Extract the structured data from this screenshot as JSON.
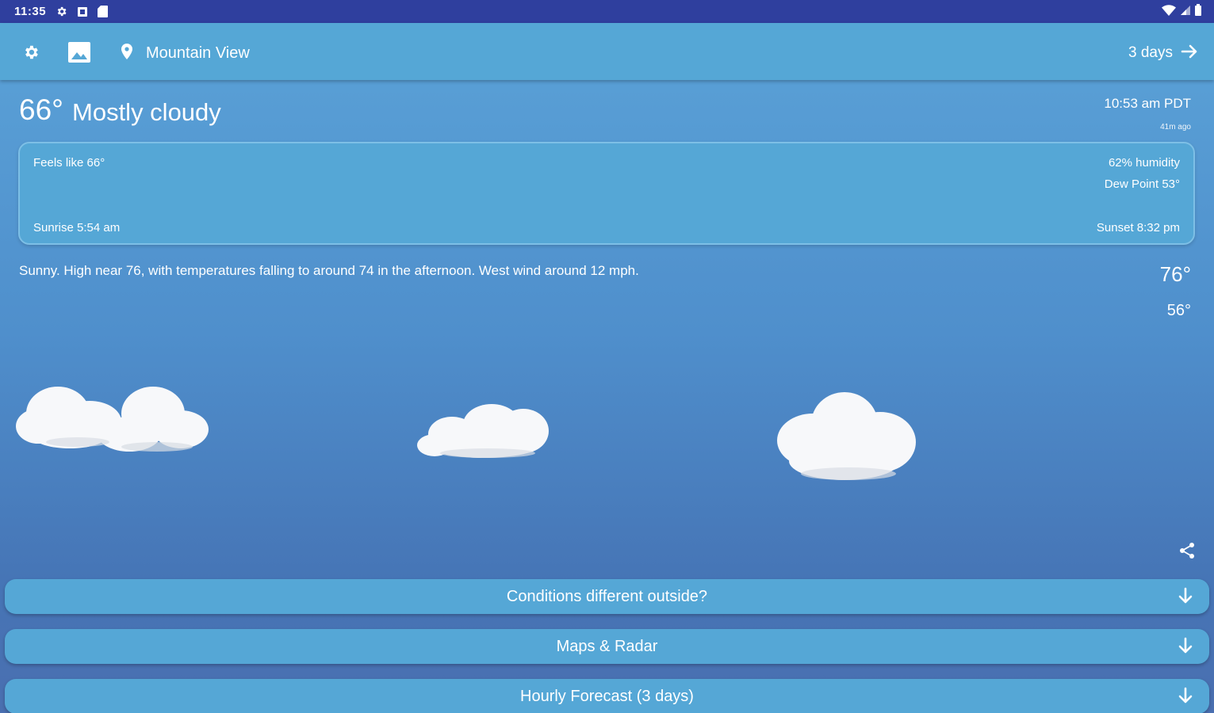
{
  "status_bar": {
    "time": "11:35",
    "icons": [
      "gear-icon",
      "square-icon",
      "sd-card-icon"
    ],
    "right_icons": [
      "wifi-icon",
      "signal-icon",
      "battery-icon"
    ]
  },
  "toolbar": {
    "settings_icon": "gear-icon",
    "image_icon": "image-icon",
    "location_icon": "location-pin-icon",
    "location": "Mountain View",
    "days_label": "3 days",
    "days_icon": "arrow-right-icon"
  },
  "current": {
    "temperature": "66°",
    "condition": "Mostly cloudy",
    "observed_time": "10:53 am PDT",
    "observed_ago": "41m ago"
  },
  "details": {
    "feels_like": "Feels like 66°",
    "humidity": "62% humidity",
    "dew_point": "Dew Point 53°",
    "sunrise": "Sunrise 5:54 am",
    "sunset": "Sunset 8:32 pm"
  },
  "forecast": {
    "text": "Sunny. High near 76, with temperatures falling to around 74 in the afternoon. West wind around 12 mph.",
    "high": "76°",
    "low": "56°"
  },
  "share_icon": "share-icon",
  "panels": [
    {
      "label": "Conditions different outside?",
      "icon": "arrow-down-icon"
    },
    {
      "label": "Maps & Radar",
      "icon": "arrow-down-icon"
    },
    {
      "label": "Hourly Forecast (3 days)",
      "icon": "arrow-down-icon"
    }
  ],
  "colors": {
    "status_bar": "#2f3f9e",
    "toolbar": "#55a7d6",
    "sky_top": "#5ba3d8",
    "sky_bottom": "#4a6fb0",
    "text": "#ffffff"
  }
}
